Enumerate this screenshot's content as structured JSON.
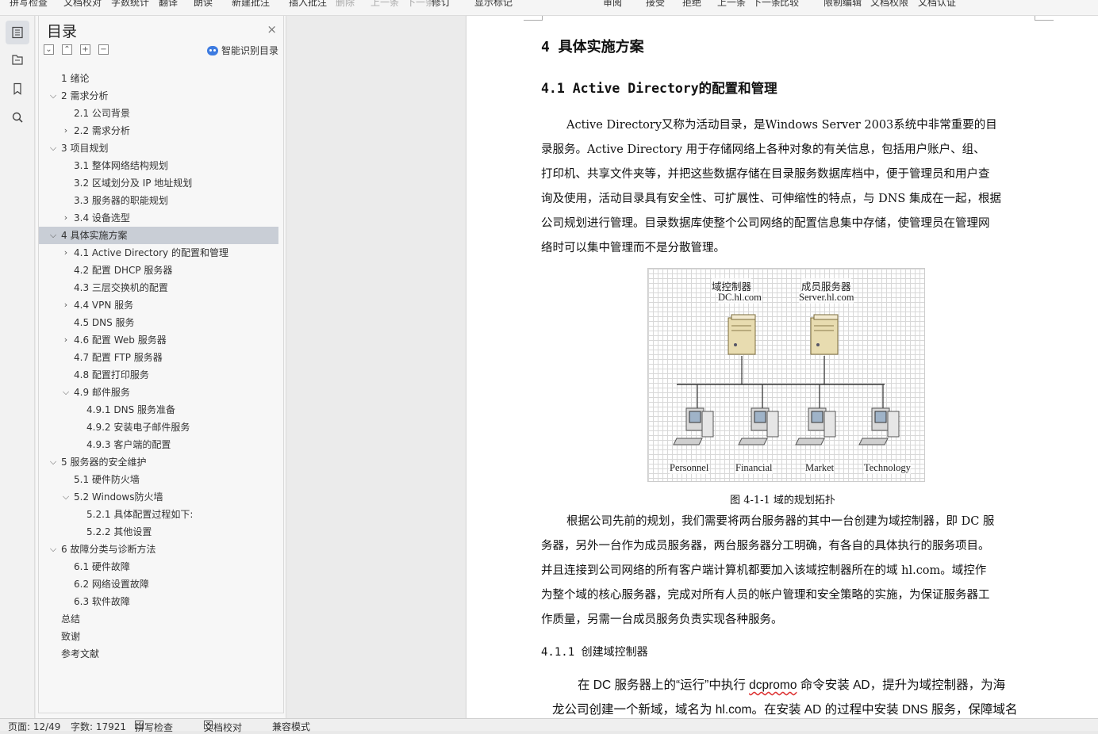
{
  "ribbon": {
    "items": [
      "拼写检查",
      "文档校对",
      "字数统计",
      "翻译",
      "朗读",
      "新建批注",
      "插入批注",
      "删除",
      "上一条",
      "下一条",
      "修订",
      "显示标记",
      "审阅",
      "接受",
      "拒绝",
      "上一条",
      "下一条",
      "比较",
      "限制编辑",
      "文档权限",
      "文档认证"
    ]
  },
  "rail": {
    "icons": [
      "toc-icon",
      "outline-icon",
      "bookmark-icon",
      "search-icon"
    ]
  },
  "toc": {
    "title": "目录",
    "close": "×",
    "smart_label": "智能识别目录",
    "items": [
      {
        "text": "1  绪论",
        "level": 1,
        "arrow": ""
      },
      {
        "text": "2  需求分析",
        "level": 1,
        "arrow": "v"
      },
      {
        "text": "2.1 公司背景",
        "level": 2,
        "arrow": ""
      },
      {
        "text": "2.2 需求分析",
        "level": 2,
        "arrow": ">"
      },
      {
        "text": "3  项目规划",
        "level": 1,
        "arrow": "v"
      },
      {
        "text": "3.1 整体网络结构规划",
        "level": 2,
        "arrow": ""
      },
      {
        "text": "3.2 区域划分及 IP 地址规划",
        "level": 2,
        "arrow": ""
      },
      {
        "text": "3.3 服务器的职能规划",
        "level": 2,
        "arrow": ""
      },
      {
        "text": "3.4  设备选型",
        "level": 2,
        "arrow": ">"
      },
      {
        "text": "4  具体实施方案",
        "level": 1,
        "arrow": "v",
        "selected": true
      },
      {
        "text": "4.1 Active Directory 的配置和管理",
        "level": 2,
        "arrow": ">"
      },
      {
        "text": "4.2  配置 DHCP 服务器",
        "level": 2,
        "arrow": ""
      },
      {
        "text": "4.3  三层交换机的配置",
        "level": 2,
        "arrow": ""
      },
      {
        "text": "4.4 VPN 服务",
        "level": 2,
        "arrow": ">"
      },
      {
        "text": "4.5 DNS 服务",
        "level": 2,
        "arrow": ""
      },
      {
        "text": "4.6  配置 Web 服务器",
        "level": 2,
        "arrow": ">"
      },
      {
        "text": "4.7  配置 FTP 服务器",
        "level": 2,
        "arrow": ""
      },
      {
        "text": "4.8 配置打印服务",
        "level": 2,
        "arrow": ""
      },
      {
        "text": "4.9  邮件服务",
        "level": 2,
        "arrow": "v"
      },
      {
        "text": "4.9.1 DNS 服务准备",
        "level": 3,
        "arrow": ""
      },
      {
        "text": "4.9.2  安装电子邮件服务",
        "level": 3,
        "arrow": ""
      },
      {
        "text": "4.9.3  客户端的配置",
        "level": 3,
        "arrow": ""
      },
      {
        "text": "5  服务器的安全维护",
        "level": 1,
        "arrow": "v"
      },
      {
        "text": "5.1  硬件防火墙",
        "level": 2,
        "arrow": ""
      },
      {
        "text": "5.2 Windows防火墙",
        "level": 2,
        "arrow": "v"
      },
      {
        "text": "5.2.1  具体配置过程如下:",
        "level": 3,
        "arrow": ""
      },
      {
        "text": "5.2.2  其他设置",
        "level": 3,
        "arrow": ""
      },
      {
        "text": "6  故障分类与诊断方法",
        "level": 1,
        "arrow": "v"
      },
      {
        "text": "6.1 硬件故障",
        "level": 2,
        "arrow": ""
      },
      {
        "text": "6.2 网络设置故障",
        "level": 2,
        "arrow": ""
      },
      {
        "text": "6.3  软件故障",
        "level": 2,
        "arrow": ""
      },
      {
        "text": "总结",
        "level": 1,
        "arrow": ""
      },
      {
        "text": "致谢",
        "level": 1,
        "arrow": ""
      },
      {
        "text": "参考文献",
        "level": 1,
        "arrow": ""
      }
    ]
  },
  "document": {
    "h1": "4 具体实施方案",
    "h2": "4.1 Active Directory的配置和管理",
    "para1": [
      "Active Directory又称为活动目录，是Windows Server 2003系统中非常重要的目",
      "录服务。Active Directory 用于存储网络上各种对象的有关信息，包括用户账户、组、",
      "打印机、共享文件夹等，并把这些数据存储在目录服务数据库档中，便于管理员和用户查",
      "询及使用，活动目录具有安全性、可扩展性、可伸缩性的特点，与 DNS 集成在一起，根据",
      "公司规划进行管理。目录数据库使整个公司网络的配置信息集中存储，使管理员在管理网",
      "络时可以集中管理而不是分散管理。"
    ],
    "figure": {
      "server1_name": "域控制器",
      "server1_host": "DC.hl.com",
      "server2_name": "成员服务器",
      "server2_host": "Server.hl.com",
      "clients": [
        "Personnel",
        "Financial",
        "Market",
        "Technology"
      ]
    },
    "caption": "图 4-1-1 域的规划拓扑",
    "para2": [
      "根据公司先前的规划，我们需要将两台服务器的其中一台创建为域控制器，即 DC 服",
      "务器，另外一台作为成员服务器，两台服务器分工明确，有各自的具体执行的服务项目。",
      "并且连接到公司网络的所有客户端计算机都要加入该域控制器所在的域 hl.com。域控作",
      "为整个域的核心服务器，完成对所有人员的帐户管理和安全策略的实施，为保证服务器工",
      "作质量，另需一台成员服务负责实现各种服务。"
    ],
    "h3": "4.1.1 创建域控制器",
    "para3_a": "在 DC 服务器上的“运行”中执行 ",
    "para3_cmd": "dcpromo",
    "para3_b": " 命令安装 AD，提升为域控制器，为海",
    "para3_line2": "龙公司创建一个新域，域名为 hl.com。在安装 AD 的过程中安装 DNS 服务，保障域名"
  },
  "status": {
    "page": "页面: 12/49",
    "words": "字数: 17921",
    "spell": "拼写检查",
    "proof": "文档校对",
    "compat": "兼容模式"
  }
}
